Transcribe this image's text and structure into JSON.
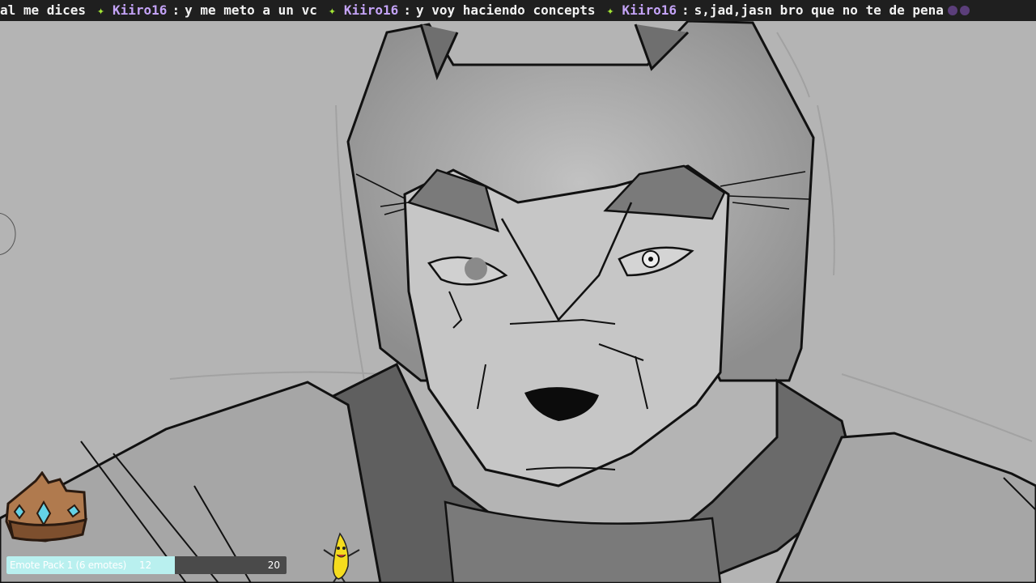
{
  "ticker": {
    "lead_text": "al me dices",
    "messages": [
      {
        "user": "Kiiro16",
        "separator": ":",
        "text": "y me meto a un vc"
      },
      {
        "user": "Kiiro16",
        "separator": ":",
        "text": "y voy haciendo concepts"
      },
      {
        "user": "Kiiro16",
        "separator": ":",
        "text": "s,jad,jasn bro que no te de pena"
      }
    ],
    "star_icon": "star-icon",
    "tail_icon": "emote-icon"
  },
  "emote_goal": {
    "label": "Emote Pack 1 (6 emotes)",
    "current": "12",
    "target": "20",
    "progress": 0.6,
    "fill_color": "#b9f0ef"
  },
  "overlay": {
    "crown_icon": "crown-icon",
    "banana_icon": "dancing-banana-icon",
    "cursor_icon": "brush-cursor-icon"
  },
  "colors": {
    "ticker_bg": "#1f1f1f",
    "username": "#c4a3f7",
    "star": "#a3e635",
    "canvas_bg": "#b3b3b3"
  }
}
